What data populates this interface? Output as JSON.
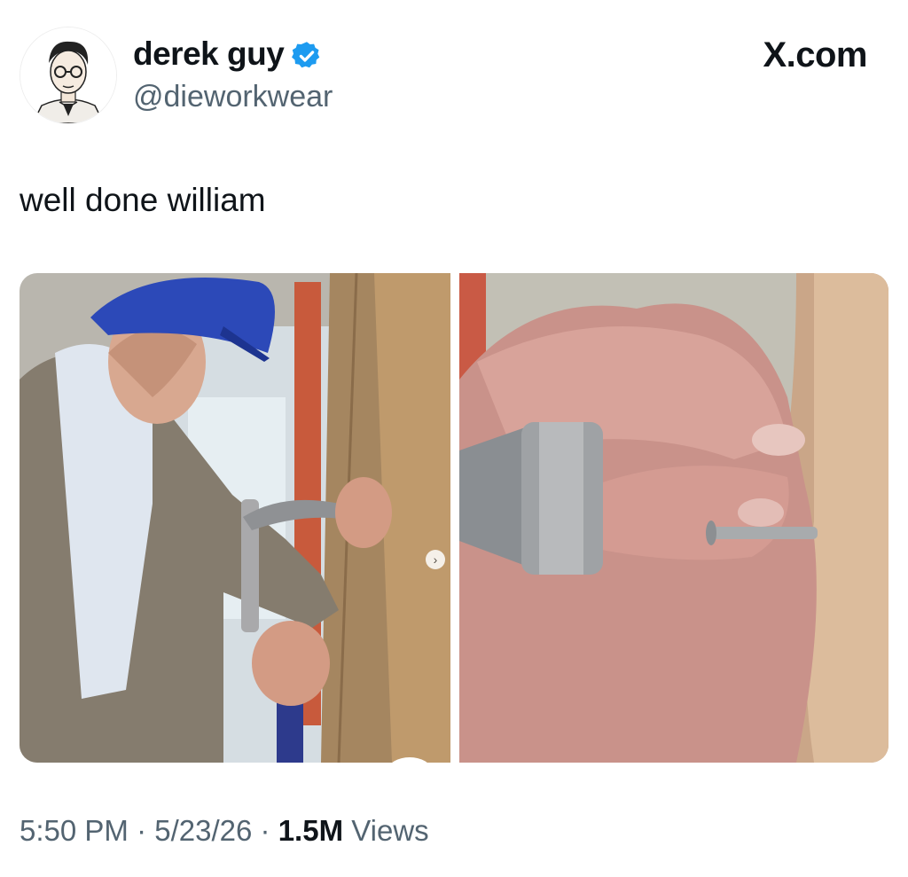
{
  "author": {
    "display_name": "derek guy",
    "handle": "@dieworkwear",
    "verified": true,
    "avatar_icon": "illustrated-portrait"
  },
  "brand": {
    "label": "X.com"
  },
  "tweet": {
    "text": "well done william"
  },
  "media": {
    "count": 2,
    "photos": [
      {
        "icon": "man-in-hard-hat-hammering-photo"
      },
      {
        "icon": "close-up-hand-holding-nail-photo"
      }
    ],
    "next_icon": "›"
  },
  "meta": {
    "time": "5:50 PM",
    "sep1": "·",
    "date": "5/23/26",
    "sep2": "·",
    "views_count": "1.5M",
    "views_label": "Views"
  },
  "colors": {
    "verified_blue": "#1d9bf0",
    "secondary_text": "#536471",
    "primary_text": "#0f1419"
  }
}
